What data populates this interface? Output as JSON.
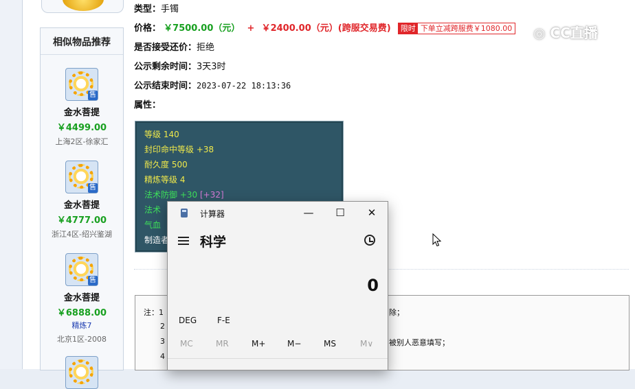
{
  "left_panel": {
    "heading": "相似物品推荐",
    "items": [
      {
        "name": "金水菩提",
        "price": "￥4499.00",
        "extra": "",
        "server": "上海2区-徐家汇"
      },
      {
        "name": "金水菩提",
        "price": "￥4777.00",
        "extra": "",
        "server": "浙江4区-绍兴鉴湖"
      },
      {
        "name": "金水菩提",
        "price": "￥6888.00",
        "extra": "精炼7",
        "server": "北京1区-2008"
      }
    ],
    "sale_badge": "售"
  },
  "detail": {
    "type_label": "类型：",
    "type_value": "手镯",
    "price_label": "价格：",
    "price_main": "￥7500.00（元）",
    "price_plus": "+",
    "price_fee": "￥2400.00（元）(跨服交易费)",
    "badge_limit": "限时",
    "badge_text": "下单立减跨服费￥1080.00",
    "bargain_label": "是否接受还价：",
    "bargain_value": "拒绝",
    "remaining_label": "公示剩余时间：",
    "remaining_value": "3天3时",
    "end_label": "公示结束时间：",
    "end_value": "2023-07-22 18:13:36",
    "attr_label": "属性："
  },
  "watermark": "CC直播",
  "attributes": [
    {
      "text": "等级 140",
      "color": "#f0e94a"
    },
    {
      "text": "封印命中等级 +38",
      "color": "#f0e94a"
    },
    {
      "text": "耐久度 500",
      "color": "#f0e94a"
    },
    {
      "text": "精炼等级 4",
      "color": "#f0e94a"
    },
    {
      "text": "法术防御 +30",
      "extra": "[+32]",
      "color": "#3ee05a",
      "extra_color": "#d67ad6"
    },
    {
      "text": "法术",
      "color": "#3ee05a"
    },
    {
      "text": "气血",
      "color": "#3ee05a"
    },
    {
      "text": "制造者",
      "color": "#ffffff"
    }
  ],
  "notes": {
    "prefix": "注：1",
    "l2": "2",
    "l3": "3",
    "l4": "4",
    "r1": "除；",
    "r3": "被别人恶意填写；"
  },
  "calculator": {
    "title": "计算器",
    "mode": "科学",
    "display": "0",
    "minimize": "—",
    "maximize": "☐",
    "close": "✕",
    "fn_buttons": [
      "DEG",
      "F-E"
    ],
    "memory_buttons": [
      {
        "label": "MC",
        "enabled": false
      },
      {
        "label": "MR",
        "enabled": false
      },
      {
        "label": "M+",
        "enabled": true
      },
      {
        "label": "M−",
        "enabled": true
      },
      {
        "label": "MS",
        "enabled": true
      },
      {
        "label": "M∨",
        "enabled": false
      }
    ]
  }
}
